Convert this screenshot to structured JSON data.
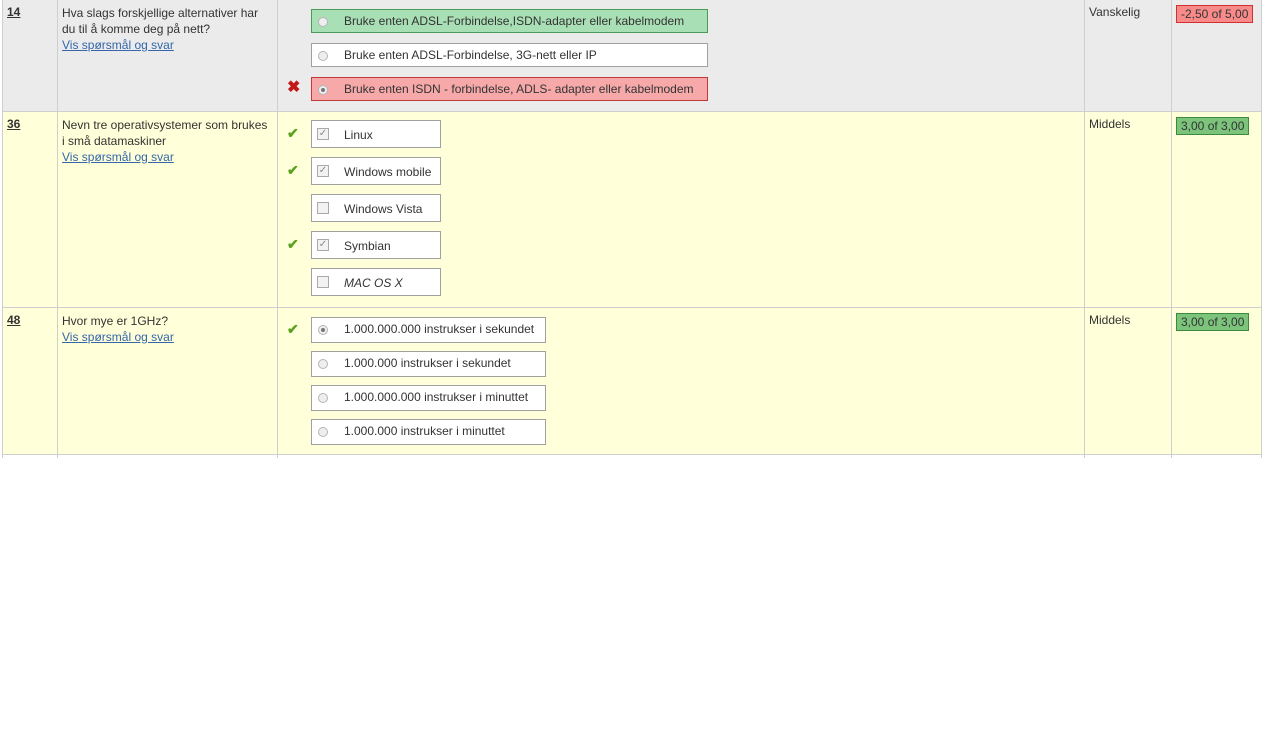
{
  "questions": [
    {
      "number": "14",
      "text": "Hva slags forskjellige alternativer har du til å komme deg på nett?",
      "link": "Vis spørsmål og svar",
      "difficulty": "Vanskelig",
      "score": "-2,50 of 5,00",
      "score_status": "bad",
      "options": [
        {
          "label": "Bruke enten ADSL-Forbindelse,ISDN-adapter eller kabelmodem",
          "state": "correct",
          "selected": false
        },
        {
          "label": "Bruke enten ADSL-Forbindelse, 3G-nett eller IP",
          "state": "neutral",
          "selected": false
        },
        {
          "label": "Bruke enten ISDN - forbindelse, ADLS- adapter eller kabelmodem",
          "state": "wrong",
          "selected": true,
          "mark": "cross"
        }
      ]
    },
    {
      "number": "36",
      "text": "Nevn tre operativsystemer som brukes i små datamaskiner",
      "link": "Vis spørsmål og svar",
      "difficulty": "Middels",
      "score": "3,00 of 3,00",
      "score_status": "good",
      "options": [
        {
          "label": "Linux",
          "checked": true,
          "mark": "check"
        },
        {
          "label": "Windows mobile",
          "checked": true,
          "mark": "check"
        },
        {
          "label": "Windows Vista",
          "checked": false
        },
        {
          "label": "Symbian",
          "checked": true,
          "mark": "check"
        },
        {
          "label": "MAC OS X",
          "checked": false,
          "italic": true
        }
      ]
    },
    {
      "number": "48",
      "text": "Hvor mye er 1GHz?",
      "link": "Vis spørsmål og svar",
      "difficulty": "Middels",
      "score": "3,00 of 3,00",
      "score_status": "good",
      "options": [
        {
          "label": "1.000.000.000 instrukser i sekundet",
          "selected": true,
          "mark": "check"
        },
        {
          "label": "1.000.000 instrukser i sekundet",
          "selected": false
        },
        {
          "label": "1.000.000.000 instrukser i minuttet",
          "selected": false
        },
        {
          "label": "1.000.000 instrukser i minuttet",
          "selected": false
        }
      ]
    }
  ],
  "colors": {
    "row_grey": "#ebebeb",
    "row_yellow": "#ffffd9",
    "correct_bg": "#a9dfb5",
    "wrong_bg": "#f7a9a9",
    "score_bad": "#f98a8a",
    "score_good": "#7cc47c",
    "link": "#3366aa"
  }
}
